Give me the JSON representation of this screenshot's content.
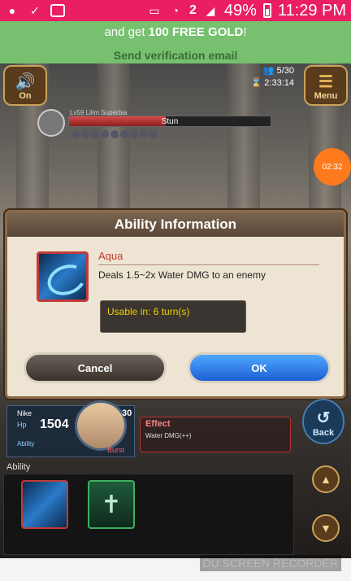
{
  "status_bar": {
    "battery": "49%",
    "time": "11:29 PM",
    "notif_count": "2"
  },
  "banner": {
    "line1_prefix": "and get ",
    "line1_bold": "100 FREE GOLD",
    "line1_suffix": "!",
    "link": "Send verification email"
  },
  "game": {
    "sound_btn": "On",
    "menu_btn": "Menu",
    "party_count": "5/30",
    "elapsed": "2:33:14",
    "enemy_name": "Lv59 Lilim Superbia",
    "enemy_hp_text": "Stun",
    "timer": "02:32"
  },
  "dialog": {
    "title": "Ability Information",
    "skill_name": "Aqua",
    "skill_desc": "Deals 1.5~2x Water DMG to an enemy",
    "usable": "Usable in: 6 turn(s)",
    "cancel": "Cancel",
    "ok": "OK"
  },
  "hero": {
    "name": "Nike",
    "hp_label": "Hp",
    "hp": "1504",
    "ability_label": "Ability",
    "level": "30",
    "burst": "Burst",
    "effect_label": "Effect",
    "effect_text": "Water DMG(++)",
    "back": "Back"
  },
  "ability_section": {
    "label": "Ability"
  },
  "recorder": "DU SCREEN RECORDER"
}
